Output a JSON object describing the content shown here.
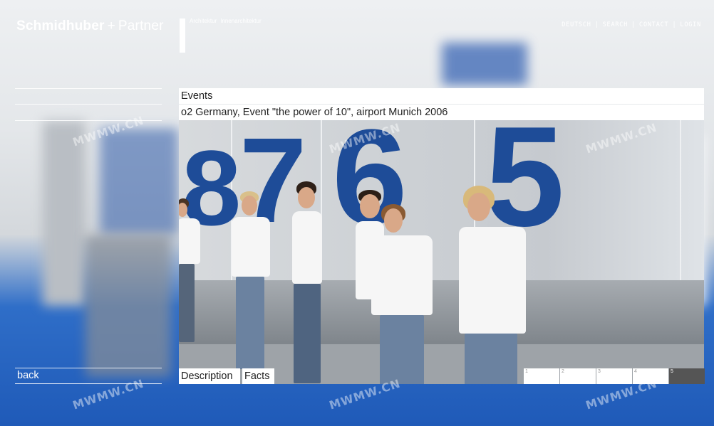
{
  "brand": {
    "name": "Schmidhuber",
    "plus": "+",
    "partner": "Partner"
  },
  "tagline": [
    "Architektur",
    "Innenarchitektur"
  ],
  "top_nav": [
    "DEUTSCH",
    "SEARCH",
    "CONTACT",
    "LOGIN"
  ],
  "top_nav_separator": "|",
  "section": "Events",
  "project_title": "o2 Germany, Event \"the power of 10\", airport Munich 2006",
  "photo": {
    "wall_numbers": [
      "8",
      "7",
      "6",
      "5"
    ]
  },
  "tabs": [
    "Description",
    "Facts"
  ],
  "pages": [
    "1",
    "2",
    "3",
    "4",
    "5"
  ],
  "active_page": "5",
  "back_label": "back",
  "watermark": "MWMW.CN",
  "colors": {
    "accent_blue": "#1e4c98",
    "active_page_bg": "#555555",
    "panel_bg": "#ffffff"
  }
}
